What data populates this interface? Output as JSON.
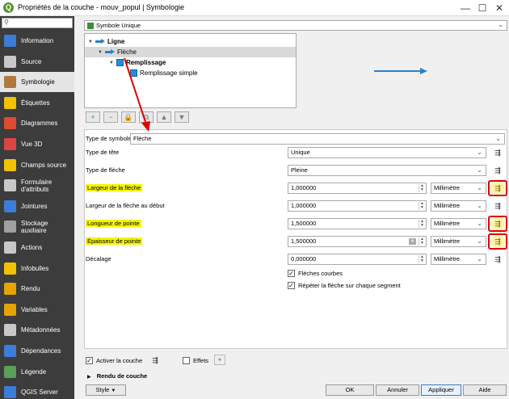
{
  "window": {
    "title": "Propriétés de la couche - mouv_popul | Symbologie",
    "app_icon": "Q",
    "minimize": "—",
    "maximize": "☐",
    "close": "✕"
  },
  "sidebar": {
    "search_placeholder": "",
    "items": [
      {
        "label": "Information",
        "icon": "info-icon",
        "color": "#3b7dd8"
      },
      {
        "label": "Source",
        "icon": "source-icon",
        "color": "#c8c8c8"
      },
      {
        "label": "Symbologie",
        "icon": "paintbrush-icon",
        "color": "#b07a3a",
        "active": true
      },
      {
        "label": "Étiquettes",
        "icon": "labels-icon",
        "color": "#f2c200"
      },
      {
        "label": "Diagrammes",
        "icon": "diagrams-icon",
        "color": "#e04b2d"
      },
      {
        "label": "Vue 3D",
        "icon": "cube-icon",
        "color": "#d44"
      },
      {
        "label": "Champs source",
        "icon": "fields-icon",
        "color": "#f2c200"
      },
      {
        "label": "Formulaire d'attributs",
        "icon": "form-icon",
        "color": "#c8c8c8"
      },
      {
        "label": "Jointures",
        "icon": "joins-icon",
        "color": "#3b7dd8"
      },
      {
        "label": "Stockage auxiliaire",
        "icon": "storage-icon",
        "color": "#a0a0a0"
      },
      {
        "label": "Actions",
        "icon": "gear-icon",
        "color": "#c8c8c8"
      },
      {
        "label": "Infobulles",
        "icon": "tooltip-icon",
        "color": "#f2c200"
      },
      {
        "label": "Rendu",
        "icon": "brush-icon",
        "color": "#e6a400"
      },
      {
        "label": "Variables",
        "icon": "variables-icon",
        "color": "#e6a400"
      },
      {
        "label": "Métadonnées",
        "icon": "metadata-icon",
        "color": "#c8c8c8"
      },
      {
        "label": "Dépendances",
        "icon": "dependencies-icon",
        "color": "#3b7dd8"
      },
      {
        "label": "Légende",
        "icon": "legend-icon",
        "color": "#58a058"
      },
      {
        "label": "QGIS Server",
        "icon": "server-icon",
        "color": "#3b7dd8"
      }
    ]
  },
  "renderer_combo": {
    "value": "Symbole Unique"
  },
  "symbol_tree": {
    "items": [
      {
        "label": "Ligne",
        "bold": true
      },
      {
        "label": "Flèche",
        "selected": true
      },
      {
        "label": "Remplissage",
        "bold": true
      },
      {
        "label": "Remplissage simple"
      }
    ]
  },
  "tree_toolbar": [
    "+",
    "−",
    "🔒",
    "⧉",
    "▲",
    "▼"
  ],
  "symbol_type": {
    "label": "Type de symbole",
    "value": "Flèche"
  },
  "properties": [
    {
      "label": "Type de tête",
      "value": "Unique",
      "kind": "combo",
      "highlight": false
    },
    {
      "label": "Type de flèche",
      "value": "Pleine",
      "kind": "combo",
      "highlight": false
    },
    {
      "label": "Largeur de la flèche",
      "value": "1,000000",
      "unit": "Millimètre",
      "kind": "spin",
      "highlight": true
    },
    {
      "label": "Largeur de la flèche au début",
      "value": "1,000000",
      "unit": "Millimètre",
      "kind": "spin",
      "highlight": false
    },
    {
      "label": "Longueur de pointe",
      "value": "1,500000",
      "unit": "Millimètre",
      "kind": "spin",
      "highlight": true
    },
    {
      "label": "Épaisseur de pointe",
      "value": "1,500000",
      "unit": "Millimètre",
      "kind": "spin",
      "highlight": true
    },
    {
      "label": "Décalage",
      "value": "0,000000",
      "unit": "Millimètre",
      "kind": "spin",
      "highlight": false
    }
  ],
  "checkboxes": [
    {
      "label": "Flèches courbes",
      "checked": true
    },
    {
      "label": "Répéter la flèche sur chaque segment",
      "checked": true
    }
  ],
  "layer": {
    "activate_label": "Activer la couche",
    "activate_checked": true,
    "effects_label": "Effets",
    "effects_checked": false,
    "render_section": "Rendu de couche"
  },
  "buttons": {
    "style": "Style",
    "ok": "OK",
    "cancel": "Annuler",
    "apply": "Appliquer",
    "help": "Aide"
  },
  "colors": {
    "accent_blue": "#2d7fc9",
    "highlight_yellow": "#f4f400",
    "annotation_red": "#e00000",
    "sidebar_bg": "#3c3c3c"
  }
}
